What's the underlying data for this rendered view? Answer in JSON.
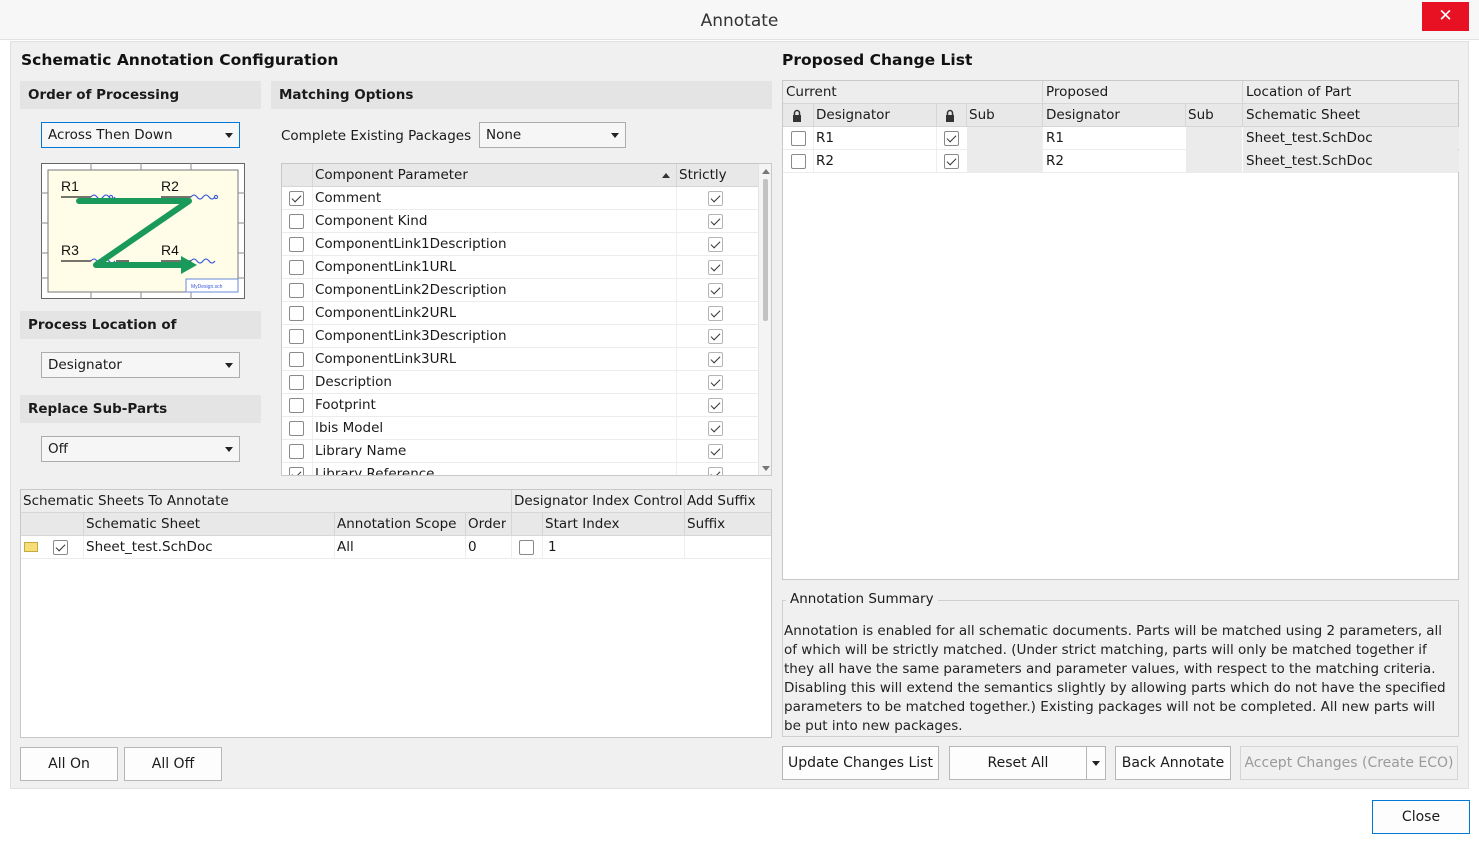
{
  "window": {
    "title": "Annotate",
    "close_glyph": "✕"
  },
  "left": {
    "heading": "Schematic Annotation Configuration",
    "order": {
      "label": "Order of Processing",
      "value": "Across Then Down"
    },
    "preview": {
      "r1": "R1",
      "r2": "R2",
      "r3": "R3",
      "r4": "R4",
      "sheet_tag": "MyDesign.sch"
    },
    "process": {
      "label": "Process Location of",
      "value": "Designator"
    },
    "replace": {
      "label": "Replace Sub-Parts",
      "value": "Off"
    },
    "matching": {
      "label": "Matching Options",
      "complete_label": "Complete Existing Packages",
      "complete_value": "None",
      "col_param": "Component Parameter",
      "col_strict": "Strictly",
      "rows": [
        {
          "name": "Comment",
          "checked": true
        },
        {
          "name": "Component Kind",
          "checked": false
        },
        {
          "name": "ComponentLink1Description",
          "checked": false
        },
        {
          "name": "ComponentLink1URL",
          "checked": false
        },
        {
          "name": "ComponentLink2Description",
          "checked": false
        },
        {
          "name": "ComponentLink2URL",
          "checked": false
        },
        {
          "name": "ComponentLink3Description",
          "checked": false
        },
        {
          "name": "ComponentLink3URL",
          "checked": false
        },
        {
          "name": "Description",
          "checked": false
        },
        {
          "name": "Footprint",
          "checked": false
        },
        {
          "name": "Ibis Model",
          "checked": false
        },
        {
          "name": "Library Name",
          "checked": false
        },
        {
          "name": "Library Reference",
          "checked": true
        }
      ]
    },
    "sheets": {
      "group1": "Schematic Sheets To Annotate",
      "group2": "Designator Index Control",
      "group3": "Add Suffix",
      "col_sheet": "Schematic Sheet",
      "col_scope": "Annotation Scope",
      "col_order": "Order",
      "col_start": "Start Index",
      "col_suffix": "Suffix",
      "rows": [
        {
          "sheet": "Sheet_test.SchDoc",
          "scope": "All",
          "order": "0",
          "start": "1",
          "suffix": ""
        }
      ]
    },
    "all_on": "All On",
    "all_off": "All Off"
  },
  "right": {
    "heading": "Proposed Change List",
    "group_current": "Current",
    "group_proposed": "Proposed",
    "group_location": "Location of Part",
    "col_designator": "Designator",
    "col_sub": "Sub",
    "col_pdesignator": "Designator",
    "col_psub": "Sub",
    "col_sheet": "Schematic Sheet",
    "rows": [
      {
        "current": "R1",
        "proposed": "R1",
        "sheet": "Sheet_test.SchDoc"
      },
      {
        "current": "R2",
        "proposed": "R2",
        "sheet": "Sheet_test.SchDoc"
      }
    ],
    "summary_label": "Annotation Summary",
    "summary_text": "Annotation is enabled for all schematic documents. Parts will be matched using 2 parameters, all of which will be strictly matched. (Under strict matching, parts will only be matched together if they all have the same parameters and parameter values, with respect to the matching criteria. Disabling this will extend the semantics slightly by allowing parts which do not have the specified parameters to be matched together.) Existing packages will not be completed. All new parts will be put into new packages.",
    "update_btn": "Update Changes List",
    "reset_btn": "Reset All",
    "back_btn": "Back Annotate",
    "accept_btn": "Accept Changes (Create ECO)"
  },
  "close_btn": "Close",
  "colors": {
    "accent": "#0078d7",
    "close_red": "#e81123",
    "preview_arrow": "#1a9a5a"
  }
}
